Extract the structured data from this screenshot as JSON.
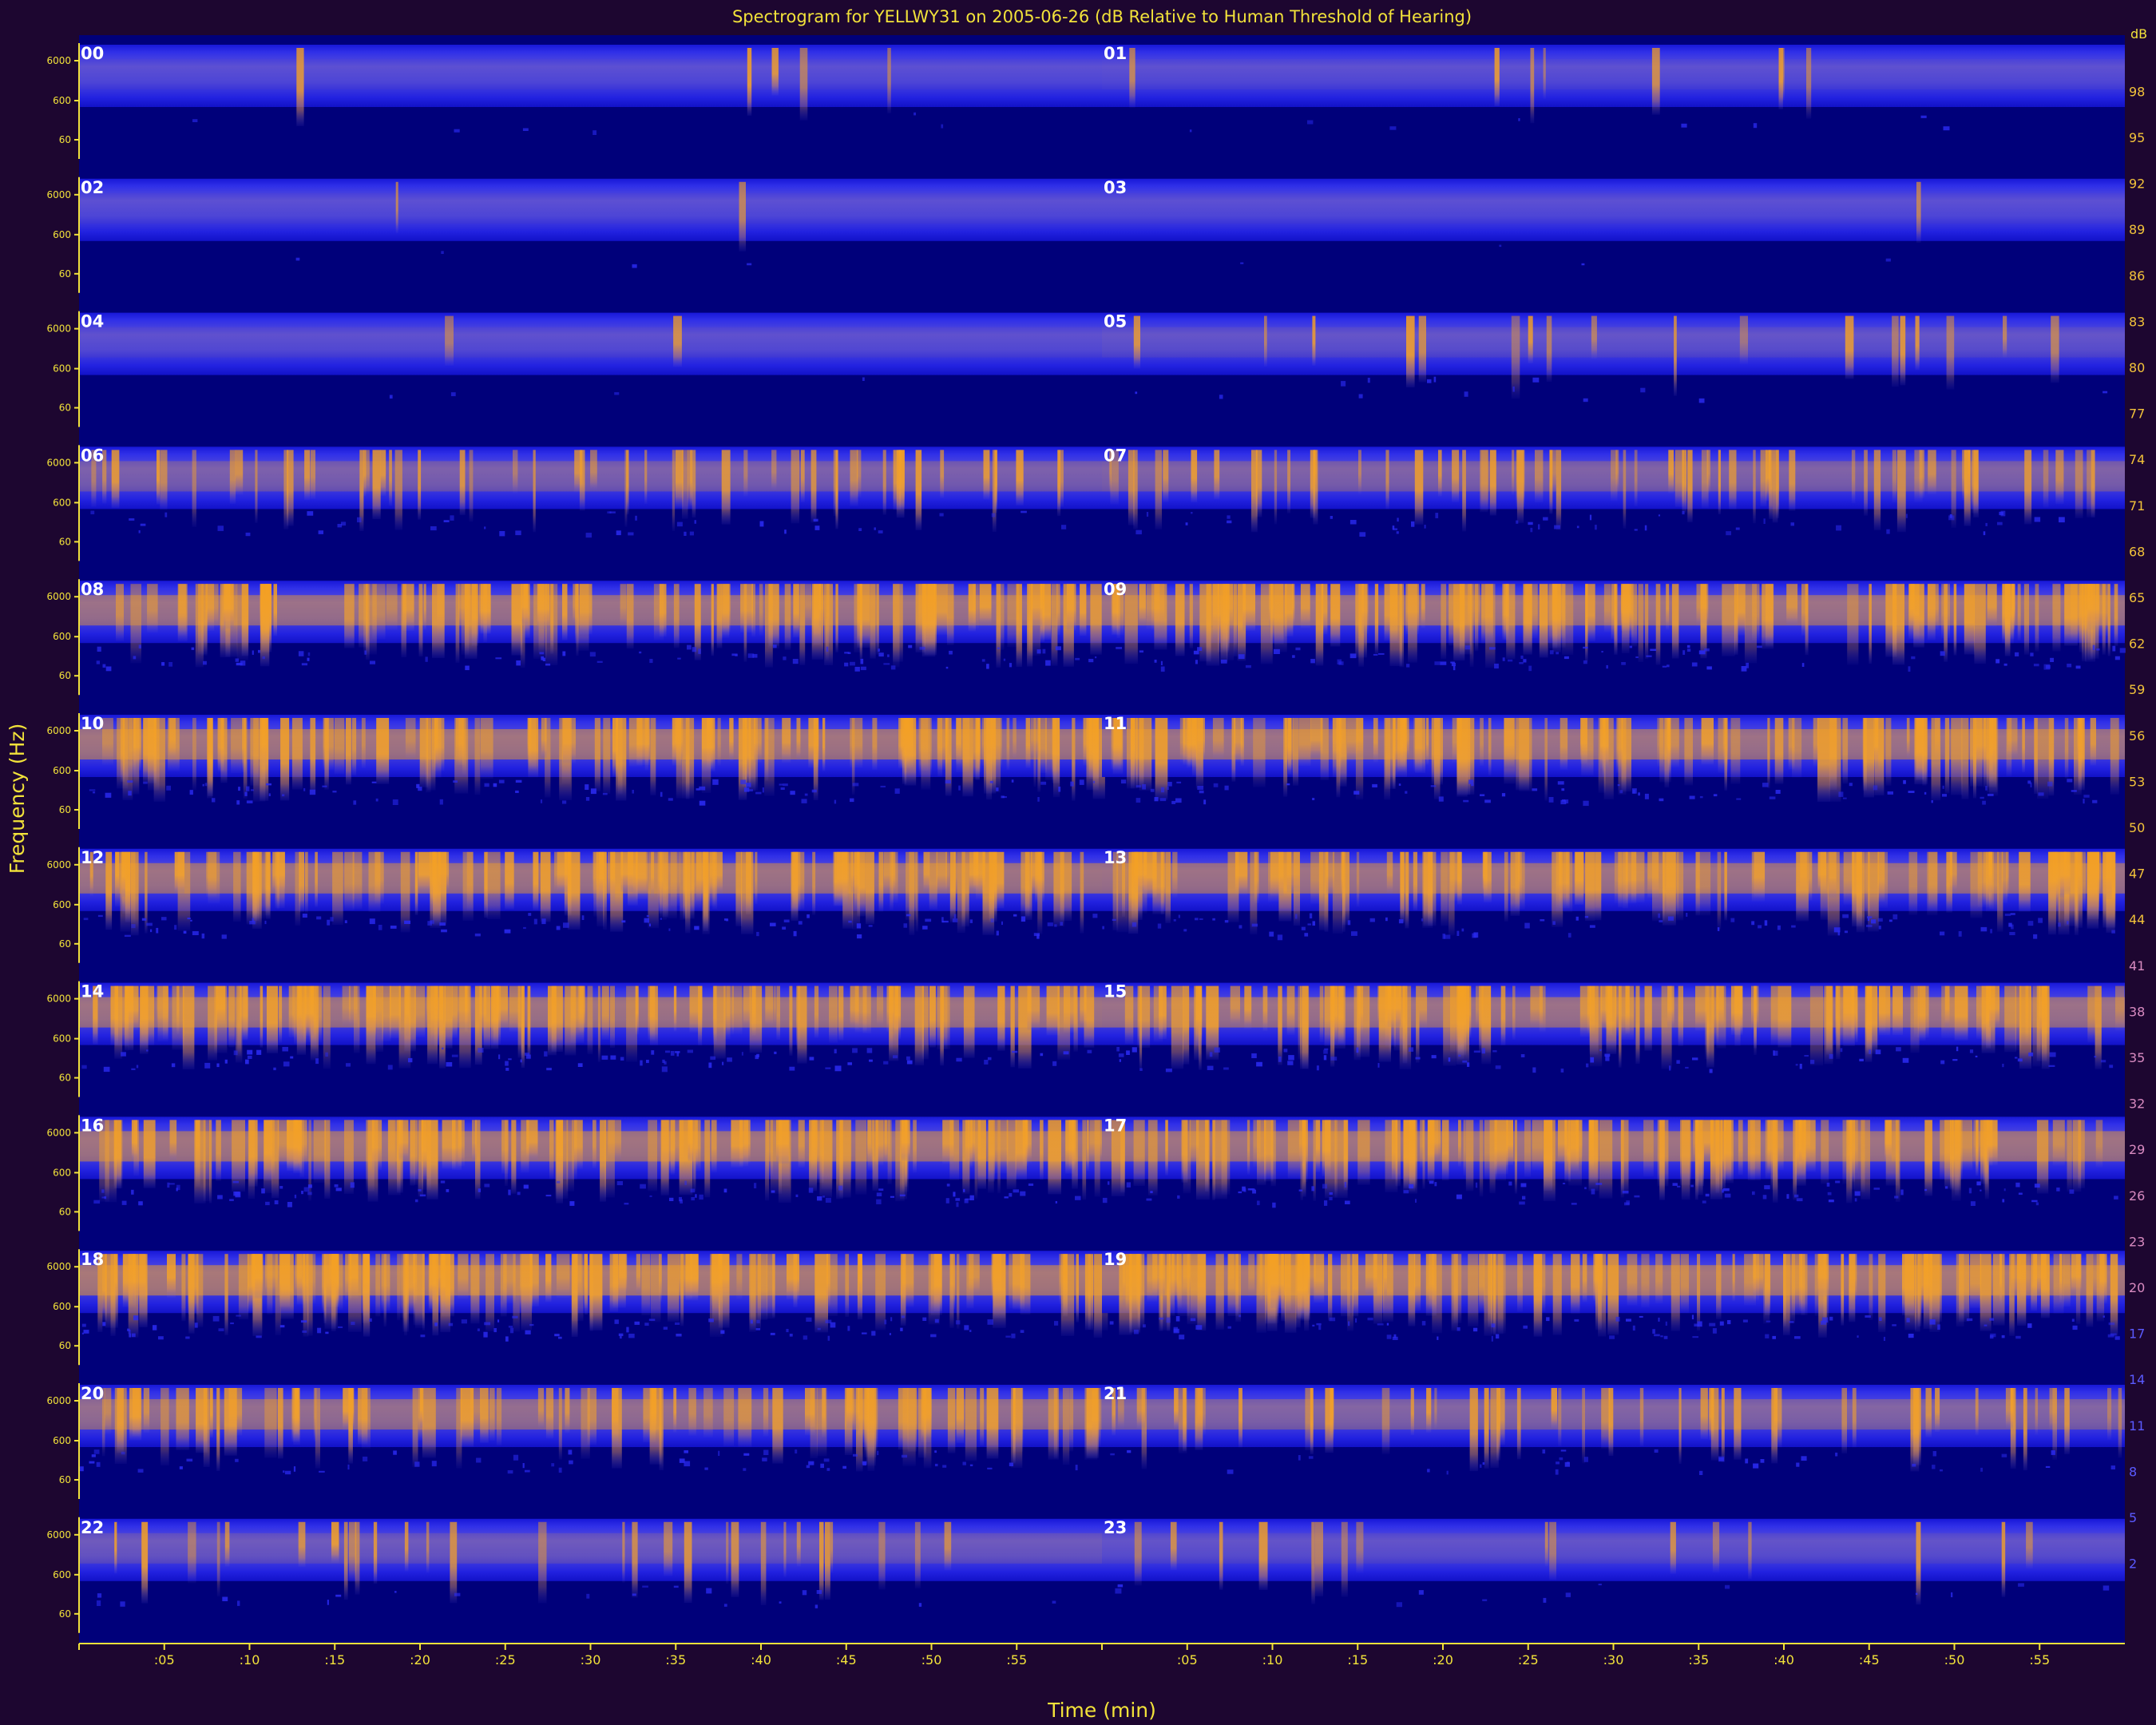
{
  "chart_data": {
    "type": "heatmap",
    "title": "Spectrogram for YELLWY31 on 2005-06-26 (dB Relative to Human Threshold of Hearing)",
    "xlabel": "Time (min)",
    "ylabel": "Frequency (Hz)",
    "colorbar_unit": "dB",
    "frequency_ticks": [
      "6000",
      "600",
      "60"
    ],
    "time_ticks": [
      ":05",
      ":10",
      ":15",
      ":20",
      ":25",
      ":30",
      ":35",
      ":40",
      ":45",
      ":50",
      ":55"
    ],
    "xlim_minutes": [
      0,
      60
    ],
    "colorbar_range_db": [
      0,
      100
    ],
    "colorbar_ticks": [
      98,
      95,
      92,
      89,
      86,
      83,
      80,
      77,
      74,
      71,
      68,
      65,
      62,
      59,
      56,
      53,
      50,
      47,
      44,
      41,
      38,
      35,
      32,
      29,
      26,
      23,
      20,
      17,
      14,
      11,
      8,
      5,
      2
    ],
    "colormap": [
      "#00007a",
      "#1a1ae6",
      "#6a5ad0",
      "#c08a70",
      "#f5a020"
    ],
    "hours": [
      {
        "label": "00",
        "activity": 0.04,
        "burst_count": 5
      },
      {
        "label": "01",
        "activity": 0.05,
        "burst_count": 8
      },
      {
        "label": "02",
        "activity": 0.03,
        "burst_count": 2
      },
      {
        "label": "03",
        "activity": 0.03,
        "burst_count": 1
      },
      {
        "label": "04",
        "activity": 0.08,
        "burst_count": 2
      },
      {
        "label": "05",
        "activity": 0.14,
        "burst_count": 18
      },
      {
        "label": "06",
        "activity": 0.42,
        "burst_count": 60
      },
      {
        "label": "07",
        "activity": 0.48,
        "burst_count": 70
      },
      {
        "label": "08",
        "activity": 0.78,
        "burst_count": 120
      },
      {
        "label": "09",
        "activity": 0.8,
        "burst_count": 125
      },
      {
        "label": "10",
        "activity": 0.85,
        "burst_count": 130
      },
      {
        "label": "11",
        "activity": 0.8,
        "burst_count": 125
      },
      {
        "label": "12",
        "activity": 0.82,
        "burst_count": 130
      },
      {
        "label": "13",
        "activity": 0.8,
        "burst_count": 125
      },
      {
        "label": "14",
        "activity": 0.82,
        "burst_count": 130
      },
      {
        "label": "15",
        "activity": 0.78,
        "burst_count": 120
      },
      {
        "label": "16",
        "activity": 0.85,
        "burst_count": 135
      },
      {
        "label": "17",
        "activity": 0.84,
        "burst_count": 130
      },
      {
        "label": "18",
        "activity": 0.92,
        "burst_count": 140
      },
      {
        "label": "19",
        "activity": 0.9,
        "burst_count": 140
      },
      {
        "label": "20",
        "activity": 0.7,
        "burst_count": 90
      },
      {
        "label": "21",
        "activity": 0.5,
        "burst_count": 55
      },
      {
        "label": "22",
        "activity": 0.26,
        "burst_count": 30
      },
      {
        "label": "23",
        "activity": 0.12,
        "burst_count": 16
      }
    ]
  }
}
